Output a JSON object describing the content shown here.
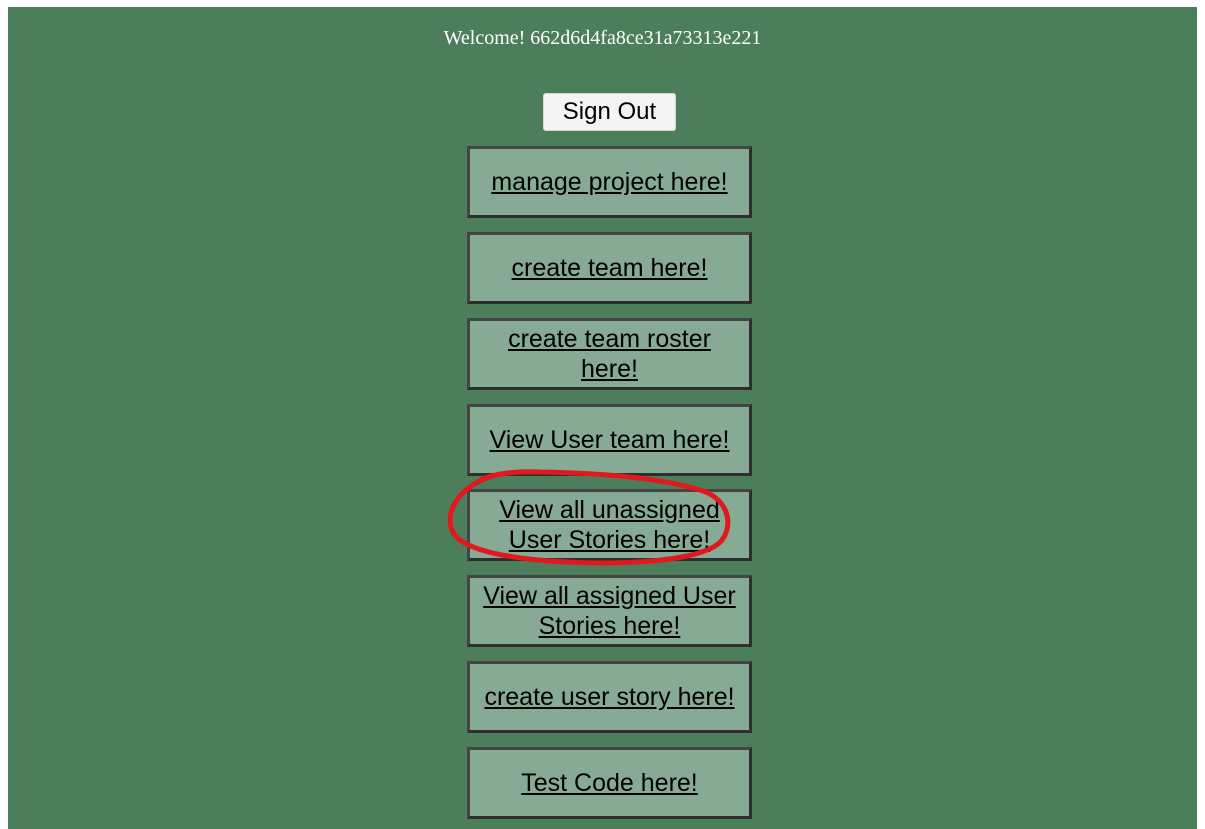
{
  "header": {
    "welcome_text": "Welcome! 662d6d4fa8ce31a73313e221"
  },
  "actions": {
    "sign_out_label": "Sign Out"
  },
  "nav_links": [
    {
      "label": "manage project here!"
    },
    {
      "label": "create team here!"
    },
    {
      "label": "create team roster here!"
    },
    {
      "label": "View User team here!"
    },
    {
      "label": "View all unassigned User Stories here!"
    },
    {
      "label": "View all assigned User Stories here!"
    },
    {
      "label": "create user story here!"
    },
    {
      "label": "Test Code here!"
    }
  ],
  "colors": {
    "page_background": "#4c7e5c",
    "link_box_background": "#86aa94",
    "annotation_circle": "#e0191e"
  }
}
